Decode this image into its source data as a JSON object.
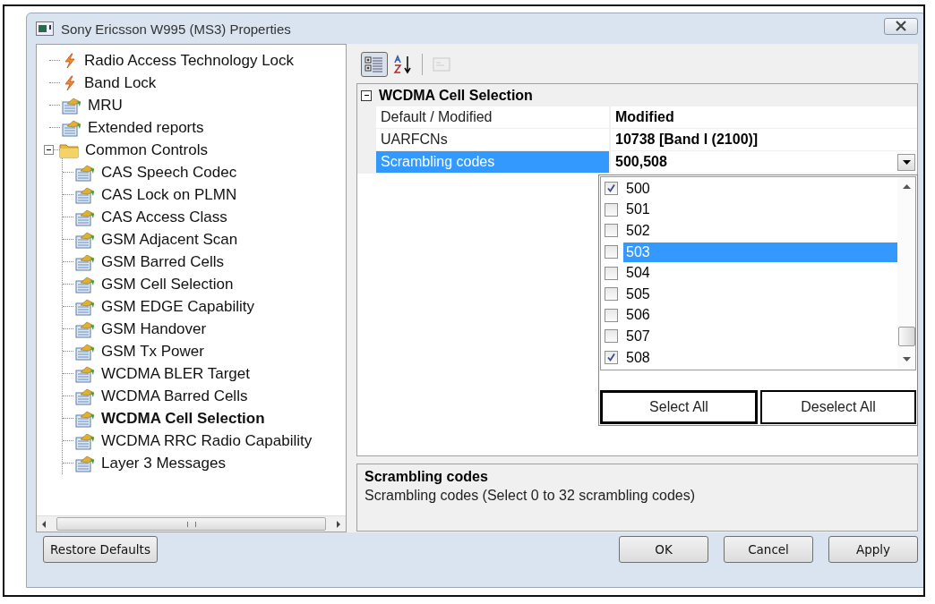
{
  "window": {
    "title": "Sony Ericsson W995 (MS3) Properties"
  },
  "tree": [
    {
      "label": "Radio Access Technology Lock",
      "kind": "lightning",
      "selected": false
    },
    {
      "label": "Band Lock",
      "kind": "lightning",
      "selected": false
    },
    {
      "label": "MRU",
      "kind": "sheet",
      "selected": false
    },
    {
      "label": "Extended reports",
      "kind": "sheet",
      "selected": false
    },
    {
      "label": "Common Controls",
      "kind": "folder",
      "selected": false,
      "expanded": true,
      "children": [
        {
          "label": "CAS Speech Codec",
          "kind": "sheet",
          "selected": false
        },
        {
          "label": "CAS Lock on PLMN",
          "kind": "sheet",
          "selected": false
        },
        {
          "label": "CAS Access Class",
          "kind": "sheet",
          "selected": false
        },
        {
          "label": "GSM Adjacent Scan",
          "kind": "sheet",
          "selected": false
        },
        {
          "label": "GSM Barred Cells",
          "kind": "sheet",
          "selected": false
        },
        {
          "label": "GSM Cell Selection",
          "kind": "sheet",
          "selected": false
        },
        {
          "label": "GSM EDGE Capability",
          "kind": "sheet",
          "selected": false
        },
        {
          "label": "GSM Handover",
          "kind": "sheet",
          "selected": false
        },
        {
          "label": "GSM Tx Power",
          "kind": "sheet",
          "selected": false
        },
        {
          "label": "WCDMA BLER Target",
          "kind": "sheet",
          "selected": false
        },
        {
          "label": "WCDMA Barred Cells",
          "kind": "sheet",
          "selected": false
        },
        {
          "label": "WCDMA Cell Selection",
          "kind": "sheet",
          "selected": true
        },
        {
          "label": "WCDMA RRC Radio Capability",
          "kind": "sheet",
          "selected": false
        },
        {
          "label": "Layer 3 Messages",
          "kind": "sheet",
          "selected": false
        }
      ]
    }
  ],
  "toolbar": [
    {
      "kind": "categorized",
      "selected": true,
      "disabled": false
    },
    {
      "kind": "alphabetical",
      "selected": false,
      "disabled": false
    },
    {
      "kind": "pages",
      "selected": false,
      "disabled": true
    }
  ],
  "property_grid": {
    "category": {
      "label": "WCDMA Cell Selection",
      "expanded": true
    },
    "rows": [
      {
        "name": "Default / Modified",
        "value": "Modified",
        "selected": false
      },
      {
        "name": "UARFCNs",
        "value": "10738 [Band I (2100)]",
        "selected": false
      },
      {
        "name": "Scrambling codes",
        "value": "500,508",
        "selected": true
      }
    ]
  },
  "dropdown": {
    "items": [
      {
        "label": "500",
        "checked": true,
        "selected": false
      },
      {
        "label": "501",
        "checked": false,
        "selected": false
      },
      {
        "label": "502",
        "checked": false,
        "selected": false
      },
      {
        "label": "503",
        "checked": false,
        "selected": true
      },
      {
        "label": "504",
        "checked": false,
        "selected": false
      },
      {
        "label": "505",
        "checked": false,
        "selected": false
      },
      {
        "label": "506",
        "checked": false,
        "selected": false
      },
      {
        "label": "507",
        "checked": false,
        "selected": false
      },
      {
        "label": "508",
        "checked": true,
        "selected": false
      }
    ],
    "buttons": [
      "Select All",
      "Deselect All"
    ]
  },
  "description": {
    "title": "Scrambling codes",
    "text": "Scrambling codes (Select 0 to 32 scrambling codes)"
  },
  "buttons": {
    "restore": "Restore Defaults",
    "ok": "OK",
    "cancel": "Cancel",
    "apply": "Apply"
  }
}
